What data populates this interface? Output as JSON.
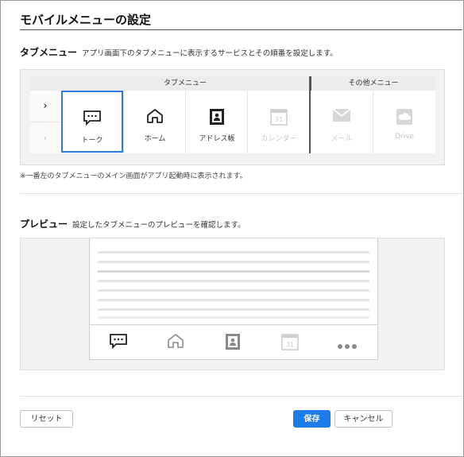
{
  "header": {
    "title": "モバイルメニューの設定"
  },
  "tab_section": {
    "label": "タブメニュー",
    "description": "アプリ画面下のタブメニューに表示するサービスとその順番を設定します。",
    "group_tab_label": "タブメニュー",
    "group_other_label": "その他メニュー",
    "nav_next": "›",
    "nav_prev": "‹",
    "tabs": [
      {
        "label": "トーク",
        "icon": "chat-icon",
        "selected": true
      },
      {
        "label": "ホーム",
        "icon": "home-icon"
      },
      {
        "label": "アドレス帳",
        "icon": "address-book-icon"
      },
      {
        "label": "カレンダー",
        "icon": "calendar-icon",
        "disabled": true
      }
    ],
    "others": [
      {
        "label": "メール",
        "icon": "mail-icon",
        "disabled": true
      },
      {
        "label": "Drive",
        "icon": "cloud-icon",
        "disabled": true
      }
    ],
    "calendar_day": "31",
    "note": "※一番左のタブメニューのメイン画面がアプリ起動時に表示されます。"
  },
  "preview_section": {
    "label": "プレビュー",
    "description": "設定したタブメニューのプレビューを確認します。",
    "tabbar_icons": [
      "chat-icon",
      "home-icon",
      "address-book-icon",
      "calendar-icon",
      "more-icon"
    ],
    "calendar_day": "31"
  },
  "footer": {
    "reset_label": "リセット",
    "save_label": "保存",
    "cancel_label": "キャンセル"
  },
  "colors": {
    "accent": "#1d7ce9",
    "selected_border": "#2d7ae0",
    "disabled": "#c8c8c8"
  }
}
